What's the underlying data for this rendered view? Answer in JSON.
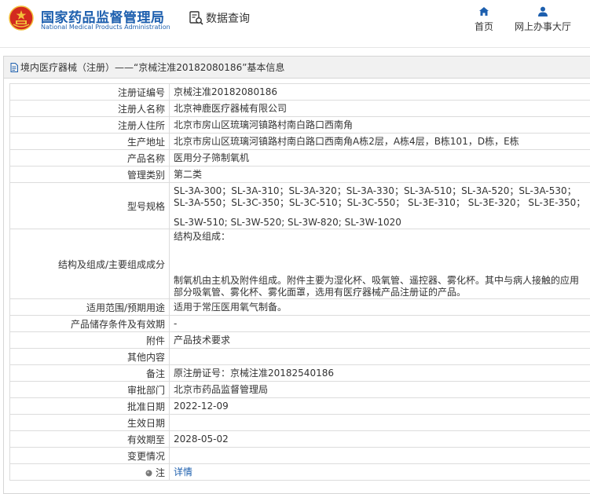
{
  "header": {
    "logo_cn": "国家药品监督管理局",
    "logo_en": "National Medical Products Administration",
    "query_label": "数据查询",
    "nav": {
      "home": "首页",
      "online": "网上办事大厅"
    }
  },
  "panel": {
    "title": "境内医疗器械（注册）——“京械注准20182080186”基本信息"
  },
  "rows": {
    "reg_no": {
      "label": "注册证编号",
      "value": "京械注准20182080186"
    },
    "registrant": {
      "label": "注册人名称",
      "value": "北京神鹿医疗器械有限公司"
    },
    "address": {
      "label": "注册人住所",
      "value": "北京市房山区琉璃河镇路村南白路口西南角"
    },
    "production": {
      "label": "生产地址",
      "value": "北京市房山区琉璃河镇路村南白路口西南角A栋2层，A栋4层，B栋101，D栋，E栋"
    },
    "product": {
      "label": "产品名称",
      "value": "医用分子筛制氧机"
    },
    "category": {
      "label": "管理类别",
      "value": "第二类"
    },
    "model": {
      "label": "型号规格",
      "value": "SL-3A-300；SL-3A-310；SL-3A-320；SL-3A-330；SL-3A-510；SL-3A-520；SL-3A-530；SL-3A-550；SL-3C-350；SL-3C-510；SL-3C-550； SL-3E-310； SL-3E-320； SL-3E-350；",
      "extra": "SL-3W-510; SL-3W-520; SL-3W-820; SL-3W-1020"
    },
    "structure": {
      "label": "结构及组成/主要组成成分",
      "head": "结构及组成：",
      "body": "制氧机由主机及附件组成。附件主要为湿化杯、吸氧管、遥控器、雾化杯。其中与病人接触的应用部分吸氧管、雾化杯、雾化面罩，选用有医疗器械产品注册证的产品。"
    },
    "scope": {
      "label": "适用范围/预期用途",
      "value": "适用于常压医用氧气制备。"
    },
    "storage": {
      "label": "产品储存条件及有效期",
      "value": "-"
    },
    "attachment": {
      "label": "附件",
      "value": "产品技术要求"
    },
    "other": {
      "label": "其他内容",
      "value": ""
    },
    "remark": {
      "label": "备注",
      "value": "原注册证号：京械注准20182540186"
    },
    "approver": {
      "label": "审批部门",
      "value": "北京市药品监督管理局"
    },
    "approval_date": {
      "label": "批准日期",
      "value": "2022-12-09"
    },
    "effective_date": {
      "label": "生效日期",
      "value": ""
    },
    "valid_until": {
      "label": "有效期至",
      "value": "2028-05-02"
    },
    "change": {
      "label": "变更情况",
      "value": ""
    },
    "note": {
      "label": "注",
      "value": "详情"
    }
  },
  "icons": {
    "emblem": "national-emblem-icon",
    "query": "data-query-icon",
    "home": "home-icon",
    "user": "user-icon",
    "doc": "document-icon",
    "note": "note-bullet-icon"
  },
  "colors": {
    "brand": "#1d5fae",
    "emblem_red": "#d32a1f",
    "emblem_gold": "#f3c13a"
  }
}
